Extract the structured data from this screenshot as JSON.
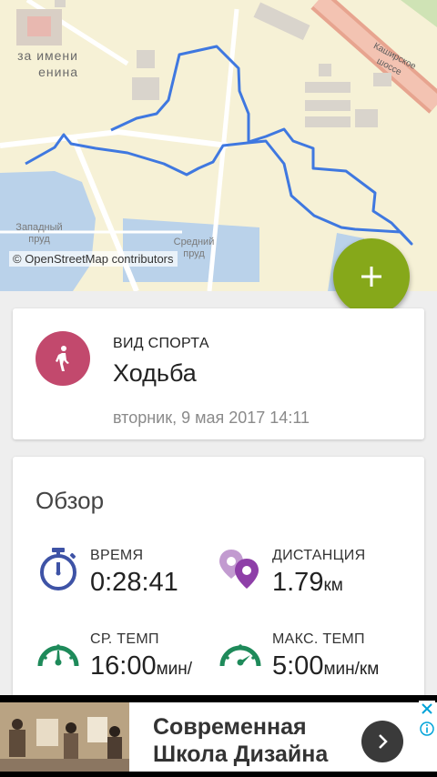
{
  "map": {
    "labels": {
      "park": "за имени\nенина",
      "road": "Каширское шоссе",
      "pond_west": "Западный\nпруд",
      "pond_middle": "Средний\nпруд"
    },
    "attribution": "© OpenStreetMap contributors",
    "route_color": "#3f78e0"
  },
  "fab": {
    "icon": "plus-icon",
    "color": "#86a81a"
  },
  "activity": {
    "sport_label": "ВИД СПОРТА",
    "sport_name": "Ходьба",
    "date": "вторник, 9 мая 2017 14:11",
    "icon": "walking-icon",
    "icon_color": "#c2496d"
  },
  "overview": {
    "title": "Обзор",
    "stats": {
      "time": {
        "label": "ВРЕМЯ",
        "value": "0:28:41",
        "unit": "",
        "icon": "stopwatch-icon",
        "color": "#3e53a6"
      },
      "distance": {
        "label": "ДИСТАНЦИЯ",
        "value": "1.79",
        "unit": "км",
        "icon": "location-pins-icon",
        "color": "#8e3fa8"
      },
      "avg_pace": {
        "label": "СР. ТЕМП",
        "value": "16:00",
        "unit": "мин/",
        "icon": "speedometer-icon",
        "color": "#1e8a5a"
      },
      "max_pace": {
        "label": "МАКС. ТЕМП",
        "value": "5:00",
        "unit": "мин/км",
        "icon": "speedometer-icon",
        "color": "#1e8a5a"
      }
    }
  },
  "ad": {
    "line1": "Современная",
    "line2": "Школа Дизайна",
    "arrow_icon": "chevron-right-icon",
    "close_icon": "close-icon",
    "info_icon": "info-icon"
  }
}
